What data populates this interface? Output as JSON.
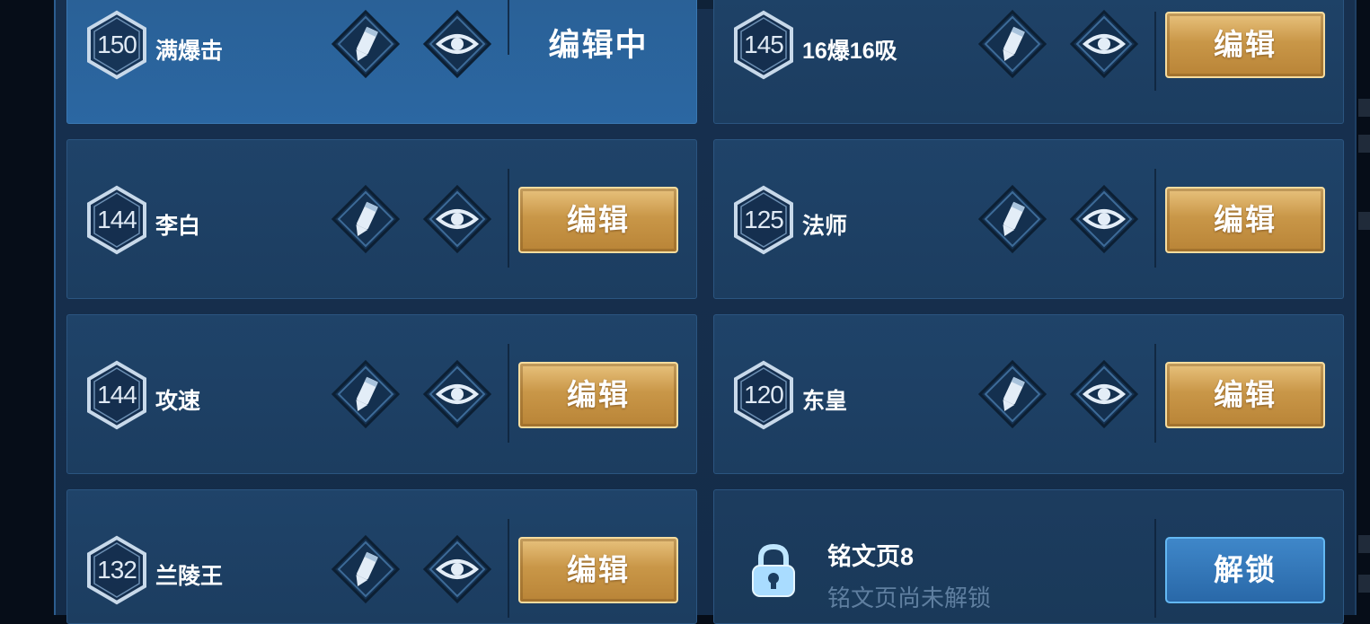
{
  "colors": {
    "gold_button": "#c99748",
    "blue_button": "#2968a8",
    "active_card": "#2b67a2",
    "card": "#1f4369",
    "tab_indicator": "#6fd2ff"
  },
  "icons": {
    "edit": "pencil-icon",
    "view": "eye-icon",
    "lock": "padlock-icon",
    "level_badge": "hexagon-badge"
  },
  "pages": [
    {
      "level": "150",
      "name": "满爆击",
      "state": "editing",
      "button_label": "编辑中"
    },
    {
      "level": "145",
      "name": "16爆16吸",
      "state": "normal",
      "button_label": "编辑"
    },
    {
      "level": "144",
      "name": "李白",
      "state": "normal",
      "button_label": "编辑"
    },
    {
      "level": "125",
      "name": "法师",
      "state": "normal",
      "button_label": "编辑"
    },
    {
      "level": "144",
      "name": "攻速",
      "state": "normal",
      "button_label": "编辑"
    },
    {
      "level": "120",
      "name": "东皇",
      "state": "normal",
      "button_label": "编辑"
    },
    {
      "level": "132",
      "name": "兰陵王",
      "state": "normal",
      "button_label": "编辑"
    },
    {
      "name": "铭文页8",
      "state": "locked",
      "subtitle": "铭文页尚未解锁",
      "button_label": "解锁"
    }
  ]
}
